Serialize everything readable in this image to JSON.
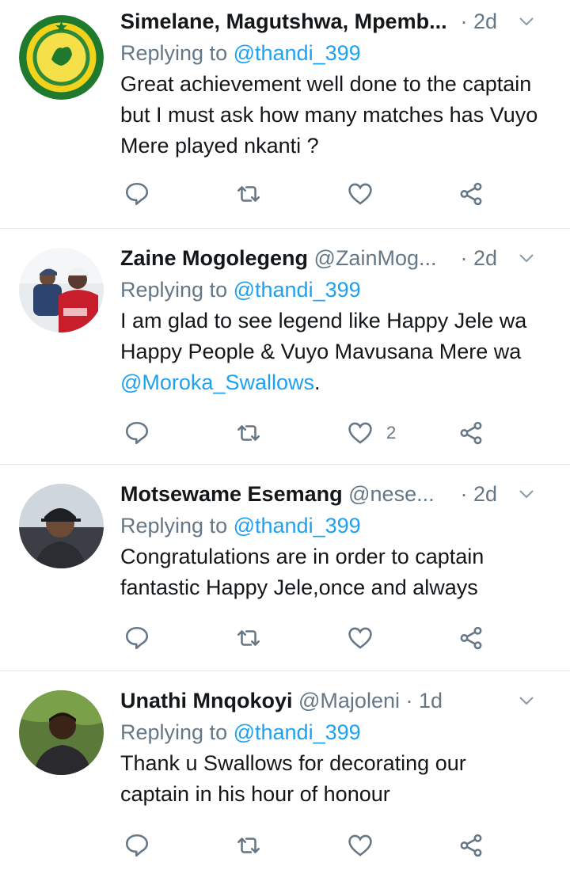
{
  "colors": {
    "accent": "#1da1f2",
    "secondary": "#657786",
    "divider": "#e1e8ed",
    "text": "#14171a"
  },
  "icons": {
    "reply": "reply-icon",
    "retweet": "retweet-icon",
    "like": "heart-icon",
    "share": "share-icon",
    "caret": "chevron-down-icon"
  },
  "tweets": [
    {
      "name": "Simelane, Magutshwa, Mpemb...",
      "handle": "",
      "time": "· 2d",
      "replying_prefix": "Replying to ",
      "replying_to": "@thandi_399",
      "text": "Great achievement well done to the captain but I must ask how many matches has Vuyo Mere played nkanti ?",
      "likes": ""
    },
    {
      "name": "Zaine Mogolegeng",
      "handle": "@ZainMog...",
      "time": "· 2d",
      "replying_prefix": "Replying to ",
      "replying_to": "@thandi_399",
      "text_before": "I am glad to see legend like Happy Jele wa Happy People & Vuyo Mavusana Mere wa ",
      "text_mention": "@Moroka_Swallows",
      "text_after": ".",
      "likes": "2"
    },
    {
      "name": "Motsewame Esemang",
      "handle": "@nese...",
      "time": "· 2d",
      "replying_prefix": "Replying to ",
      "replying_to": "@thandi_399",
      "text": "Congratulations are in order to captain fantastic Happy Jele,once and always",
      "likes": ""
    },
    {
      "name": "Unathi Mnqokoyi",
      "handle": "@Majoleni",
      "time": "· 1d",
      "replying_prefix": "Replying to ",
      "replying_to": "@thandi_399",
      "text": "Thank u Swallows for decorating our captain in his hour of honour",
      "likes": ""
    }
  ]
}
